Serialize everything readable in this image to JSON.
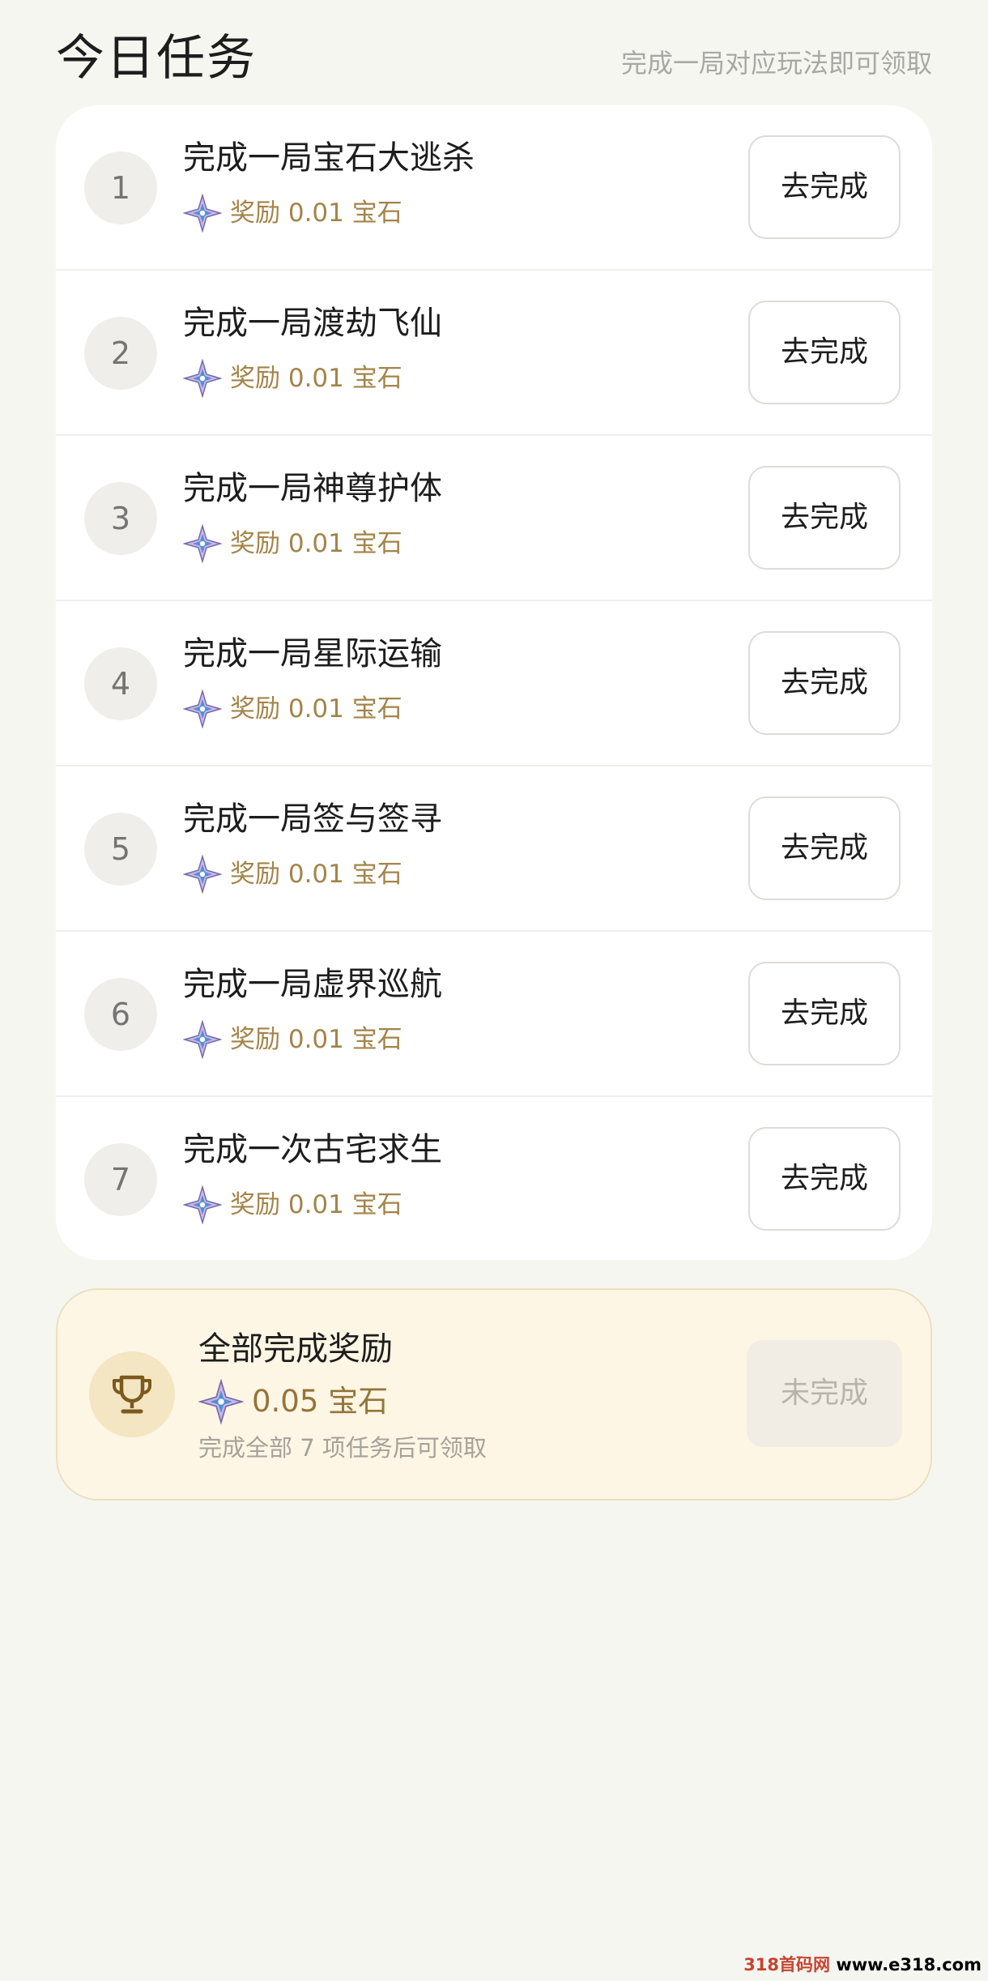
{
  "header": {
    "title": "今日任务",
    "subtitle": "完成一局对应玩法即可领取"
  },
  "tasks": [
    {
      "number": "1",
      "title": "完成一局宝石大逃杀",
      "reward": "奖励 0.01 宝石",
      "button": "去完成"
    },
    {
      "number": "2",
      "title": "完成一局渡劫飞仙",
      "reward": "奖励 0.01 宝石",
      "button": "去完成"
    },
    {
      "number": "3",
      "title": "完成一局神尊护体",
      "reward": "奖励 0.01 宝石",
      "button": "去完成"
    },
    {
      "number": "4",
      "title": "完成一局星际运输",
      "reward": "奖励 0.01 宝石",
      "button": "去完成"
    },
    {
      "number": "5",
      "title": "完成一局签与签寻",
      "reward": "奖励 0.01 宝石",
      "button": "去完成"
    },
    {
      "number": "6",
      "title": "完成一局虚界巡航",
      "reward": "奖励 0.01 宝石",
      "button": "去完成"
    },
    {
      "number": "7",
      "title": "完成一次古宅求生",
      "reward": "奖励 0.01 宝石",
      "button": "去完成"
    }
  ],
  "bonus": {
    "title": "全部完成奖励",
    "reward": "0.05 宝石",
    "note": "完成全部 7 项任务后可领取",
    "button": "未完成"
  },
  "watermark": {
    "site_name": "318首码网",
    "url": "www.e318.com"
  },
  "icons": {
    "gem": "gem-star-icon",
    "trophy": "trophy-icon"
  },
  "colors": {
    "page_background": "#f6f6f1",
    "card_background": "#ffffff",
    "reward_text": "#a38449",
    "bonus_background": "#fdf6e4",
    "bonus_border": "#ece0c0",
    "trophy": "#7b5a1e",
    "disabled_button": "#f1ede4"
  }
}
